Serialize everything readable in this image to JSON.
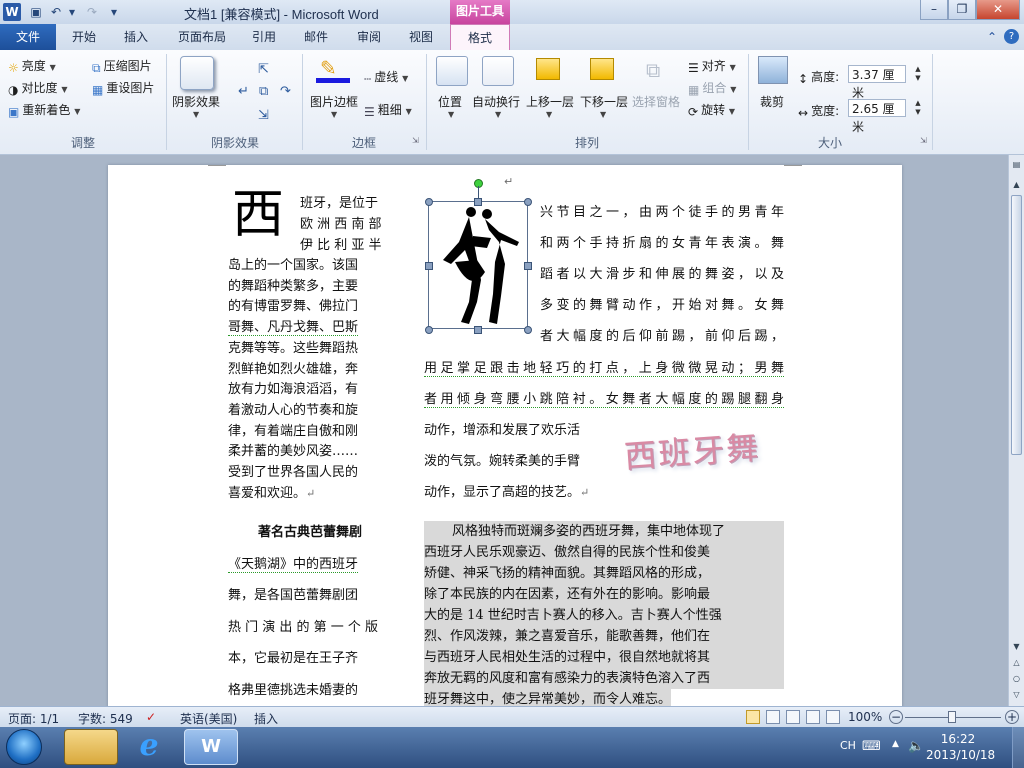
{
  "titlebar": {
    "title": "文档1 [兼容模式] - Microsoft Word",
    "context_tab": "图片工具",
    "app_letter": "W"
  },
  "tabs": {
    "file": "文件",
    "items": [
      "开始",
      "插入",
      "页面布局",
      "引用",
      "邮件",
      "审阅",
      "视图"
    ],
    "format": "格式"
  },
  "ribbon": {
    "adjust": {
      "brightness": "亮度",
      "contrast": "对比度",
      "recolor": "重新着色",
      "compress": "压缩图片",
      "reset": "重设图片",
      "label": "调整"
    },
    "shadow": {
      "shadow_effects": "阴影效果",
      "label": "阴影效果"
    },
    "border": {
      "picture_border": "图片边框",
      "dashes": "虚线",
      "weight": "粗细",
      "label": "边框"
    },
    "arrange": {
      "position": "位置",
      "wrap": "自动换行",
      "bring_forward": "上移一层",
      "send_backward": "下移一层",
      "selection_pane": "选择窗格",
      "align": "对齐",
      "group": "组合",
      "rotate": "旋转",
      "label": "排列"
    },
    "size": {
      "crop": "裁剪",
      "height_label": "高度:",
      "height_value": "3.37 厘米",
      "width_label": "宽度:",
      "width_value": "2.65 厘米",
      "label": "大小"
    }
  },
  "document": {
    "dropcap": "西",
    "left_col_lines": [
      "班牙，是位于",
      "欧 洲 西 南 部",
      "伊 比 利 亚 半",
      "岛上的一个国家。该国",
      "的舞蹈种类繁多，主要",
      "的有博雷罗舞、佛拉门",
      "哥舞、凡丹戈舞、巴斯",
      "克舞等等。这些舞蹈热",
      "烈鲜艳如烈火雄雄，奔",
      "放有力如海浪滔滔，有",
      "着激动人心的节奏和旋",
      "律，有着端庄自傲和刚",
      "柔并蓄的美妙风姿……",
      "受到了世界各国人民的",
      "喜爱和欢迎。"
    ],
    "left_col2_lines": [
      "著名古典芭蕾舞剧",
      "《天鹅湖》中的西班牙",
      "舞，是各国芭蕾舞剧团",
      "热 门 演 出 的 第 一 个 版",
      "本，它最初是在王子齐",
      "格弗里德挑选未婚妻的"
    ],
    "right_top_lines": [
      "兴节目之一，由两个徒手的男青年",
      "和两个手持折扇的女青年表演。舞",
      "蹈者以大滑步和伸展的舞姿，以及",
      "多变的舞臂动作，开始对舞。女舞",
      "者大幅度的后仰前踢，前仰后踢，"
    ],
    "right_full_lines": [
      "用足掌足跟击地轻巧的打点，上身微微晃动；男舞",
      "者用倾身弯腰小跳陪衬。女舞者大幅度的踢腿翻身"
    ],
    "right_wrap_lines": [
      "动作，增添和发展了欢乐活",
      "泼的气氛。婉转柔美的手臂",
      "动作，显示了高超的技艺。"
    ],
    "wordart": "西班牙舞",
    "shaded_lines": [
      "风格独特而斑斓多姿的西班牙舞，集中地体现了",
      "西班牙人民乐观豪迈、傲然自得的民族个性和俊美",
      "矫健、神采飞扬的精神面貌。其舞蹈风格的形成，",
      "除了本民族的内在因素，还有外在的影响。影响最",
      "大的是 14 世纪时吉卜赛人的移入。吉卜赛人个性强",
      "烈、作风泼辣，兼之喜爱音乐，能歌善舞，他们在",
      "与西班牙人民相处生活的过程中，很自然地就将其",
      "奔放无羁的风度和富有感染力的表演特色溶入了西",
      "班牙舞这中，使之异常美妙，而令人难忘。"
    ],
    "para_mark": "↵"
  },
  "status": {
    "page": "页面: 1/1",
    "words": "字数: 549",
    "language": "英语(美国)",
    "mode": "插入",
    "zoom": "100%",
    "zoom_minus": "−",
    "zoom_plus": "+"
  },
  "taskbar": {
    "lang": "CH",
    "time": "16:22",
    "date": "2013/10/18"
  },
  "colors": {
    "file_tab": "#2f6cbf",
    "context_tab": "#c8449e",
    "shaded_bg": "#d9d9d9"
  }
}
